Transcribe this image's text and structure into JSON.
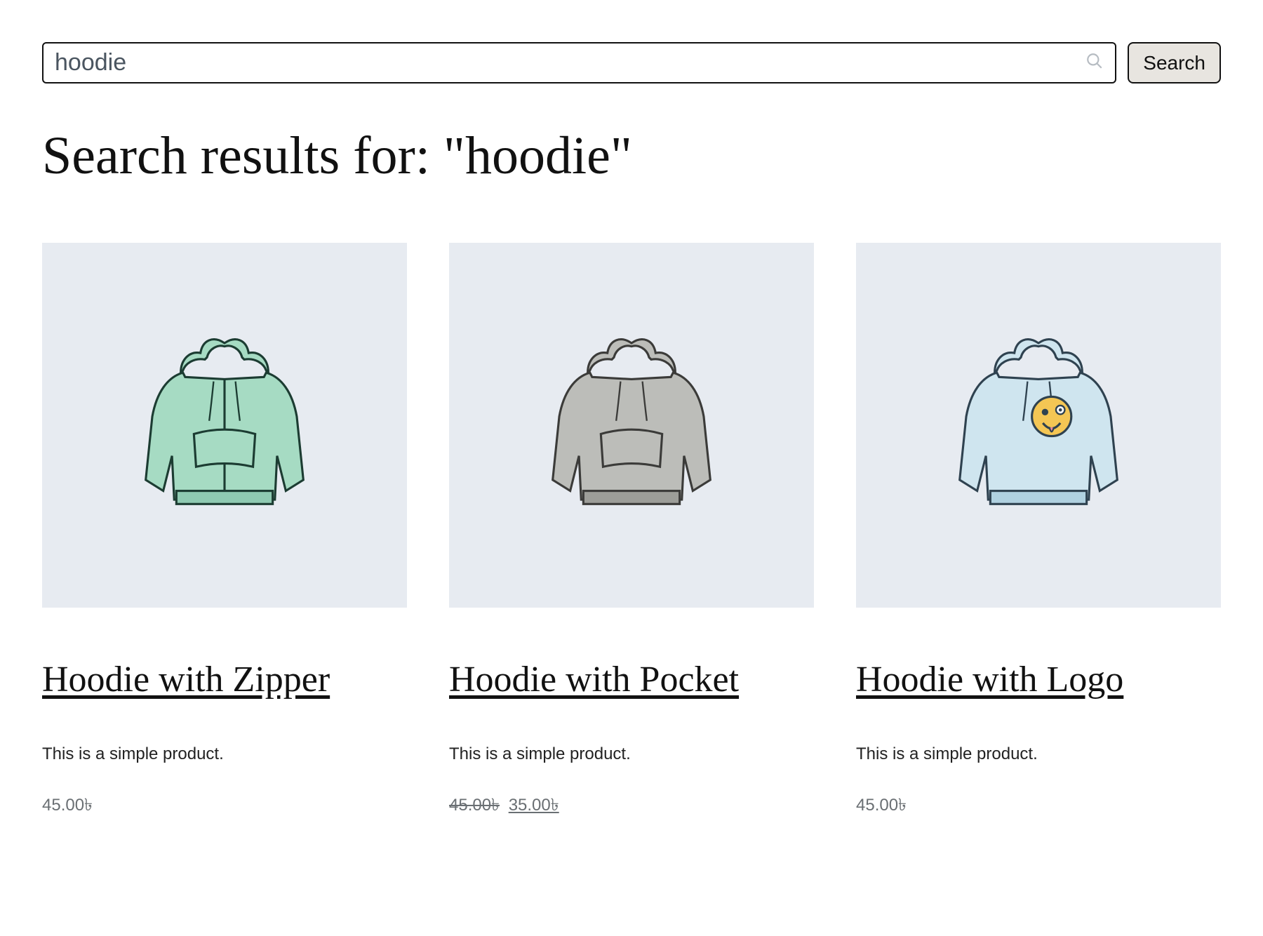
{
  "search": {
    "value": "hoodie",
    "button_label": "Search"
  },
  "heading_prefix": "Search results for: \"",
  "heading_term": "hoodie",
  "heading_suffix": "\"",
  "products": [
    {
      "title": "Hoodie with Zipper",
      "description": "This is a simple product.",
      "price": "45.00৳",
      "image": "hoodie-green-zipper"
    },
    {
      "title": "Hoodie with Pocket",
      "description": "This is a simple product.",
      "original_price": "45.00৳",
      "sale_price": "35.00৳",
      "image": "hoodie-gray-pocket"
    },
    {
      "title": "Hoodie with Logo",
      "description": "This is a simple product.",
      "price": "45.00৳",
      "image": "hoodie-blue-logo"
    }
  ]
}
